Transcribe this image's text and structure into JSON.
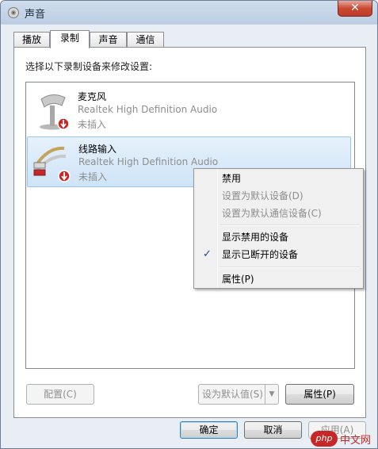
{
  "window": {
    "title": "声音",
    "close_symbol": "✕"
  },
  "tabs": [
    {
      "label": "播放"
    },
    {
      "label": "录制"
    },
    {
      "label": "声音"
    },
    {
      "label": "通信"
    }
  ],
  "panel": {
    "instruction": "选择以下录制设备来修改设置:",
    "devices": [
      {
        "name": "麦克风",
        "driver": "Realtek High Definition Audio",
        "status": "未插入",
        "icon": "microphone-icon"
      },
      {
        "name": "线路输入",
        "driver": "Realtek High Definition Audio",
        "status": "未插入",
        "icon": "line-in-icon",
        "selected": true
      }
    ],
    "buttons": {
      "configure": "配置(C)",
      "set_default": "设为默认值(S)",
      "properties": "属性(P)"
    }
  },
  "context_menu": {
    "items": [
      {
        "label": "禁用",
        "enabled": true
      },
      {
        "label": "设置为默认设备(D)",
        "enabled": false
      },
      {
        "label": "设置为默认通信设备(C)",
        "enabled": false
      },
      {
        "label": "显示禁用的设备",
        "enabled": true
      },
      {
        "label": "显示已断开的设备",
        "enabled": true,
        "checked": true
      },
      {
        "label": "属性(P)",
        "enabled": true
      }
    ],
    "check_symbol": "✓"
  },
  "footer": {
    "ok": "确定",
    "cancel": "取消",
    "apply": "应用(A)"
  },
  "watermark": {
    "badge": "php",
    "text": "中文网"
  },
  "colors": {
    "selection": "#cfe4f8",
    "status_unplugged": "#c62828",
    "disabled_text": "#8d8d8d"
  }
}
